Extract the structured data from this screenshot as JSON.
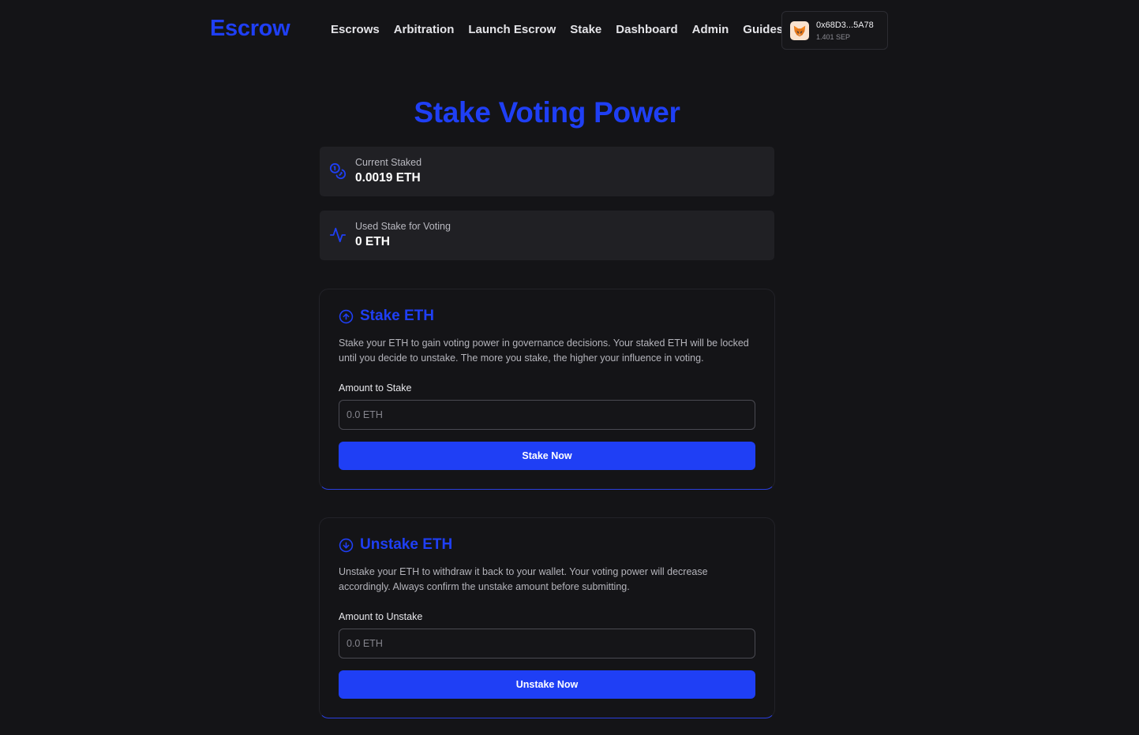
{
  "header": {
    "brand": "Escrow",
    "nav": [
      "Escrows",
      "Arbitration",
      "Launch Escrow",
      "Stake",
      "Dashboard",
      "Admin",
      "Guides"
    ],
    "wallet": {
      "address": "0x68D3...5A78",
      "balance": "1.401 SEP",
      "icon": "metamask-fox-icon"
    }
  },
  "page": {
    "title": "Stake Voting Power"
  },
  "stats": {
    "current": {
      "label": "Current Staked",
      "value": "0.0019 ETH",
      "icon": "coins-icon"
    },
    "used": {
      "label": "Used Stake for Voting",
      "value": "0 ETH",
      "icon": "activity-icon"
    }
  },
  "stake": {
    "title": "Stake ETH",
    "icon": "arrow-up-circle-icon",
    "description": "Stake your ETH to gain voting power in governance decisions. Your staked ETH will be locked until you decide to unstake. The more you stake, the higher your influence in voting.",
    "amount_label": "Amount to Stake",
    "placeholder": "0.0 ETH",
    "button": "Stake Now"
  },
  "unstake": {
    "title": "Unstake ETH",
    "icon": "arrow-down-circle-icon",
    "description": "Unstake your ETH to withdraw it back to your wallet. Your voting power will decrease accordingly. Always confirm the unstake amount before submitting.",
    "amount_label": "Amount to Unstake",
    "placeholder": "0.0 ETH",
    "button": "Unstake Now"
  },
  "colors": {
    "accent": "#1f3ff5",
    "background": "#141417",
    "card": "#202024"
  }
}
